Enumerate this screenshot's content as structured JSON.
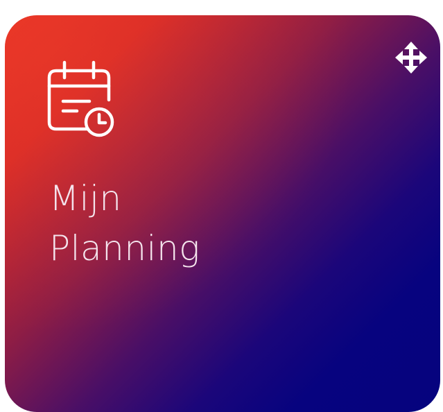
{
  "tile": {
    "title_line1": "Mijn",
    "title_line2": "Planning",
    "icon": "calendar-clock-icon",
    "drag_icon": "move-icon",
    "colors": {
      "gradient_start": "#e53124",
      "gradient_end": "#05037e",
      "foreground": "#ffffff"
    }
  }
}
